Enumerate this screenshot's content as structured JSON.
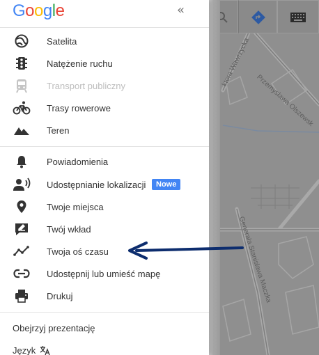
{
  "logo": {
    "letters": [
      "G",
      "o",
      "o",
      "g",
      "l",
      "e"
    ],
    "colors": [
      "#4285f4",
      "#ea4335",
      "#fbbc05",
      "#4285f4",
      "#34a853",
      "#ea4335"
    ]
  },
  "collapse_icon": "double-chevron-left-icon",
  "layers": [
    {
      "icon": "satellite-icon",
      "label": "Satelita",
      "disabled": false
    },
    {
      "icon": "traffic-icon",
      "label": "Natężenie ruchu",
      "disabled": false
    },
    {
      "icon": "transit-icon",
      "label": "Transport publiczny",
      "disabled": true
    },
    {
      "icon": "bike-icon",
      "label": "Trasy rowerowe",
      "disabled": false
    },
    {
      "icon": "terrain-icon",
      "label": "Teren",
      "disabled": false
    }
  ],
  "features": [
    {
      "icon": "bell-icon",
      "label": "Powiadomienia"
    },
    {
      "icon": "location-sharing-icon",
      "label": "Udostępnianie lokalizacji",
      "badge": "Nowe"
    },
    {
      "icon": "place-pin-icon",
      "label": "Twoje miejsca"
    },
    {
      "icon": "edit-contribution-icon",
      "label": "Twój wkład"
    },
    {
      "icon": "timeline-icon",
      "label": "Twoja oś czasu"
    },
    {
      "icon": "link-icon",
      "label": "Udostępnij lub umieść mapę"
    },
    {
      "icon": "print-icon",
      "label": "Drukuj"
    }
  ],
  "footer": {
    "tour": "Obejrzyj prezentację",
    "language": "Język"
  },
  "map": {
    "streets": [
      "ktora Wawrzycka",
      "Przemysława Olszewsk",
      "Generała Stanisława Maczka"
    ]
  },
  "colors": {
    "arrow": "#0d2d6e",
    "badge": "#4285f4",
    "directions": "#4285f4"
  }
}
